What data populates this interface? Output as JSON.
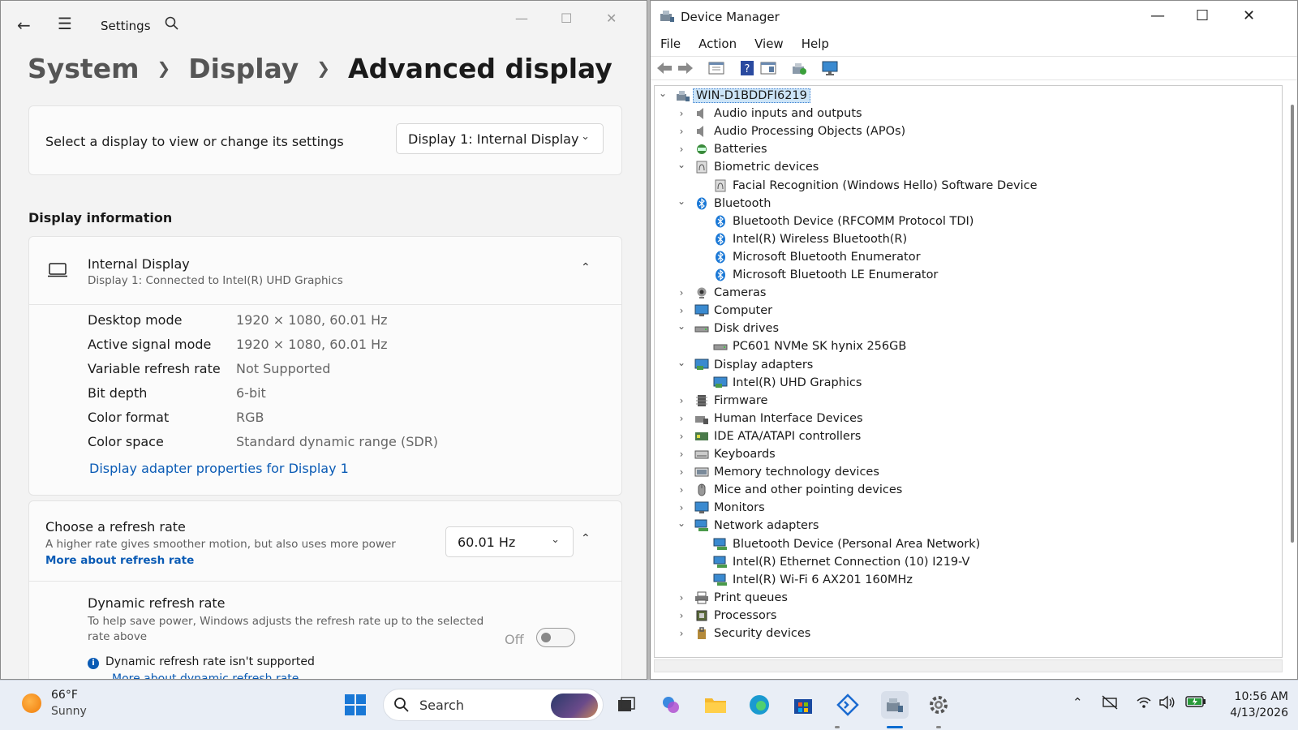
{
  "settings": {
    "app_title": "Settings",
    "breadcrumb": [
      "System",
      "Display",
      "Advanced display"
    ],
    "select_display": {
      "label": "Select a display to view or change its settings",
      "selected": "Display 1: Internal Display"
    },
    "display_info": {
      "section_title": "Display information",
      "display_name": "Internal Display",
      "display_sub": "Display 1: Connected to Intel(R) UHD Graphics",
      "rows": [
        {
          "label": "Desktop mode",
          "value": "1920 × 1080, 60.01 Hz"
        },
        {
          "label": "Active signal mode",
          "value": "1920 × 1080, 60.01 Hz"
        },
        {
          "label": "Variable refresh rate",
          "value": "Not Supported"
        },
        {
          "label": "Bit depth",
          "value": "6-bit"
        },
        {
          "label": "Color format",
          "value": "RGB"
        },
        {
          "label": "Color space",
          "value": "Standard dynamic range (SDR)"
        }
      ],
      "adapter_link": "Display adapter properties for Display 1"
    },
    "refresh_rate": {
      "title": "Choose a refresh rate",
      "subtitle": "A higher rate gives smoother motion, but also uses more power",
      "link": "More about refresh rate",
      "selected": "60.01 Hz",
      "dynamic": {
        "title": "Dynamic refresh rate",
        "subtitle": "To help save power, Windows adjusts the refresh rate up to the selected rate above",
        "toggle_state": "Off",
        "note": "Dynamic refresh rate isn't supported",
        "note_link": "More about dynamic refresh rate"
      }
    }
  },
  "device_manager": {
    "title": "Device Manager",
    "menu": [
      "File",
      "Action",
      "View",
      "Help"
    ],
    "tree": [
      {
        "label": "WIN-D1BDDFI6219",
        "level": 0,
        "expanded": true,
        "icon": "computer-root-icon"
      },
      {
        "label": "Audio inputs and outputs",
        "level": 1,
        "expanded": false,
        "icon": "speaker-icon"
      },
      {
        "label": "Audio Processing Objects (APOs)",
        "level": 1,
        "expanded": false,
        "icon": "speaker-icon"
      },
      {
        "label": "Batteries",
        "level": 1,
        "expanded": false,
        "icon": "battery-icon"
      },
      {
        "label": "Biometric devices",
        "level": 1,
        "expanded": true,
        "icon": "fingerprint-icon"
      },
      {
        "label": "Facial Recognition (Windows Hello) Software Device",
        "level": 2,
        "icon": "fingerprint-icon"
      },
      {
        "label": "Bluetooth",
        "level": 1,
        "expanded": true,
        "icon": "bluetooth-icon"
      },
      {
        "label": "Bluetooth Device (RFCOMM Protocol TDI)",
        "level": 2,
        "icon": "bluetooth-icon"
      },
      {
        "label": "Intel(R) Wireless Bluetooth(R)",
        "level": 2,
        "icon": "bluetooth-icon"
      },
      {
        "label": "Microsoft Bluetooth Enumerator",
        "level": 2,
        "icon": "bluetooth-icon"
      },
      {
        "label": "Microsoft Bluetooth LE Enumerator",
        "level": 2,
        "icon": "bluetooth-icon"
      },
      {
        "label": "Cameras",
        "level": 1,
        "expanded": false,
        "icon": "camera-icon"
      },
      {
        "label": "Computer",
        "level": 1,
        "expanded": false,
        "icon": "monitor-icon"
      },
      {
        "label": "Disk drives",
        "level": 1,
        "expanded": true,
        "icon": "disk-icon"
      },
      {
        "label": "PC601 NVMe SK hynix 256GB",
        "level": 2,
        "icon": "disk-icon"
      },
      {
        "label": "Display adapters",
        "level": 1,
        "expanded": true,
        "icon": "display-adapter-icon"
      },
      {
        "label": "Intel(R) UHD Graphics",
        "level": 2,
        "icon": "display-adapter-icon"
      },
      {
        "label": "Firmware",
        "level": 1,
        "expanded": false,
        "icon": "chip-icon"
      },
      {
        "label": "Human Interface Devices",
        "level": 1,
        "expanded": false,
        "icon": "hid-icon"
      },
      {
        "label": "IDE ATA/ATAPI controllers",
        "level": 1,
        "expanded": false,
        "icon": "controller-icon"
      },
      {
        "label": "Keyboards",
        "level": 1,
        "expanded": false,
        "icon": "keyboard-icon"
      },
      {
        "label": "Memory technology devices",
        "level": 1,
        "expanded": false,
        "icon": "memory-icon"
      },
      {
        "label": "Mice and other pointing devices",
        "level": 1,
        "expanded": false,
        "icon": "mouse-icon"
      },
      {
        "label": "Monitors",
        "level": 1,
        "expanded": false,
        "icon": "monitor-icon"
      },
      {
        "label": "Network adapters",
        "level": 1,
        "expanded": true,
        "icon": "network-icon"
      },
      {
        "label": "Bluetooth Device (Personal Area Network)",
        "level": 2,
        "icon": "network-icon"
      },
      {
        "label": "Intel(R) Ethernet Connection (10) I219-V",
        "level": 2,
        "icon": "network-icon"
      },
      {
        "label": "Intel(R) Wi-Fi 6 AX201 160MHz",
        "level": 2,
        "icon": "network-icon"
      },
      {
        "label": "Print queues",
        "level": 1,
        "expanded": false,
        "icon": "printer-icon"
      },
      {
        "label": "Processors",
        "level": 1,
        "expanded": false,
        "icon": "processor-icon"
      },
      {
        "label": "Security devices",
        "level": 1,
        "expanded": false,
        "icon": "security-icon"
      }
    ]
  },
  "taskbar": {
    "weather_temp": "66°F",
    "weather_desc": "Sunny",
    "search_placeholder": "Search",
    "time": "10:56 AM",
    "date": "4/13/2026"
  },
  "colors": {
    "accent": "#0a5bb5",
    "selection": "#cce4f7"
  }
}
